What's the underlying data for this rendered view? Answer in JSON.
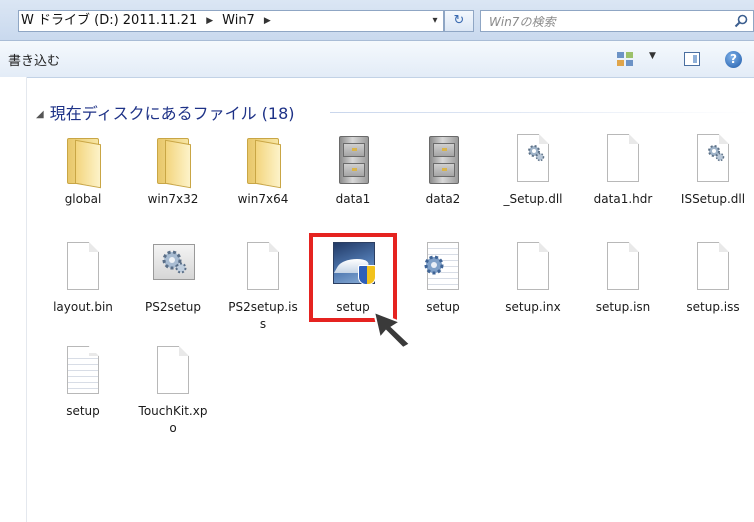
{
  "address_bar": {
    "crumbs": [
      "W ドライブ (D:) 2011.11.21",
      "Win7"
    ],
    "dropdown_glyph": "▾",
    "refresh_glyph": "↻"
  },
  "search": {
    "placeholder": "Win7の検索"
  },
  "toolbar": {
    "burn_label": "書き込む"
  },
  "group": {
    "title": "現在ディスクにあるファイル (18)"
  },
  "files": [
    {
      "name": "global",
      "icon": "folder-icon"
    },
    {
      "name": "win7x32",
      "icon": "folder-icon"
    },
    {
      "name": "win7x64",
      "icon": "folder-icon"
    },
    {
      "name": "data1",
      "icon": "cabinet-icon"
    },
    {
      "name": "data2",
      "icon": "cabinet-icon"
    },
    {
      "name": "_Setup.dll",
      "icon": "dll-gear-icon"
    },
    {
      "name": "data1.hdr",
      "icon": "document-icon"
    },
    {
      "name": "ISSetup.dll",
      "icon": "dll-gear-icon"
    },
    {
      "name": "layout.bin",
      "icon": "document-icon"
    },
    {
      "name": "PS2setup",
      "icon": "gear-app-icon"
    },
    {
      "name": "PS2setup.iss",
      "icon": "document-icon"
    },
    {
      "name": "setup",
      "icon": "installer-shield-icon"
    },
    {
      "name": "setup",
      "icon": "config-gear-icon"
    },
    {
      "name": "setup.inx",
      "icon": "document-icon"
    },
    {
      "name": "setup.isn",
      "icon": "document-icon"
    },
    {
      "name": "setup.iss",
      "icon": "document-icon"
    },
    {
      "name": "setup",
      "icon": "text-document-icon"
    },
    {
      "name": "TouchKit.xpo",
      "icon": "document-icon"
    }
  ],
  "accent": {
    "highlight": "#e52320",
    "header_text": "#1e3287"
  }
}
